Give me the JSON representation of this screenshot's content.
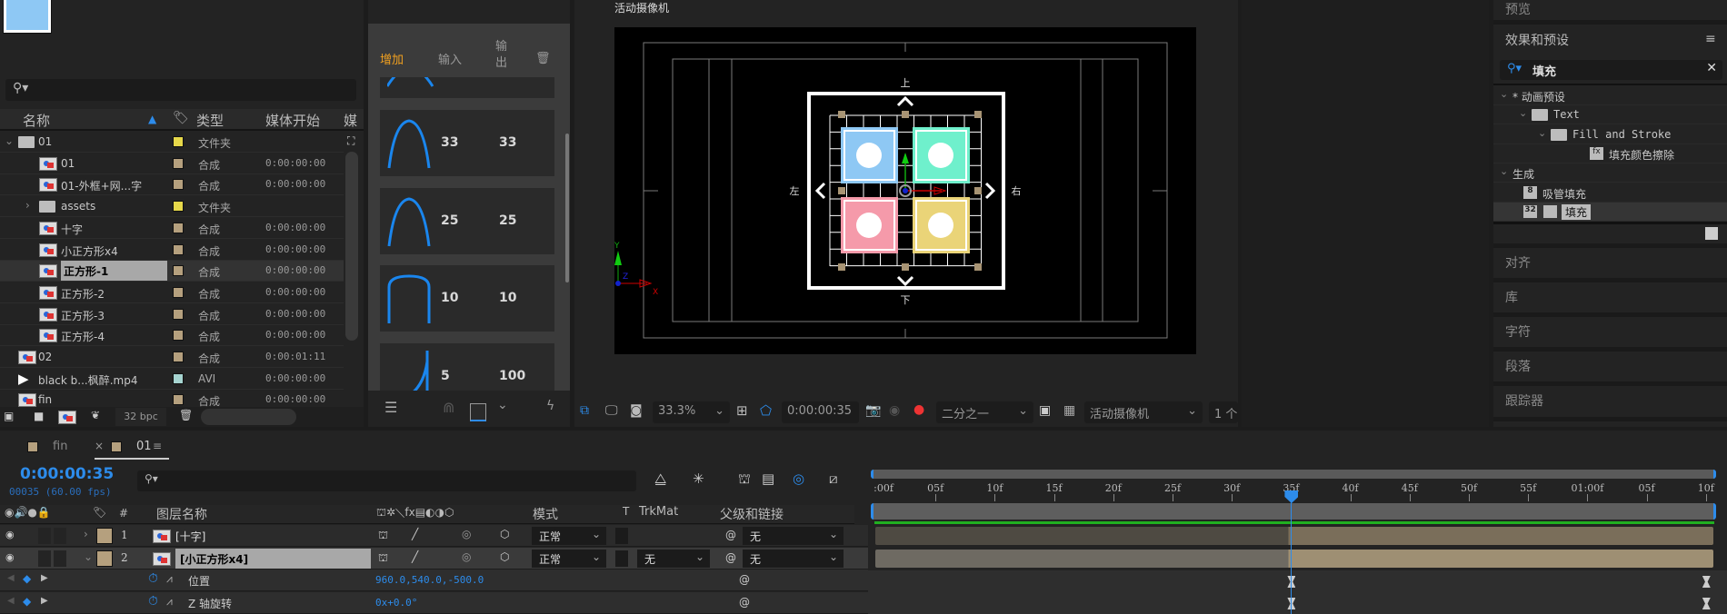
{
  "project": {
    "search_placeholder": "",
    "columns": {
      "name": "名称",
      "type": "类型",
      "media_start": "媒体开始",
      "media_more": "媒"
    },
    "items": [
      {
        "name": "01",
        "type": "文件夹",
        "start": "",
        "kind": "folder",
        "label": "#e6d84a",
        "indent": 0,
        "expanded": true
      },
      {
        "name": "01",
        "type": "合成",
        "start": "0:00:00:00",
        "kind": "comp",
        "label": "#b5a07e",
        "indent": 1
      },
      {
        "name": "01-外框+网...字",
        "type": "合成",
        "start": "0:00:00:00",
        "kind": "comp",
        "label": "#b5a07e",
        "indent": 1
      },
      {
        "name": "assets",
        "type": "文件夹",
        "start": "",
        "kind": "folder",
        "label": "#e6d84a",
        "indent": 1,
        "expanded": false
      },
      {
        "name": "十字",
        "type": "合成",
        "start": "0:00:00:00",
        "kind": "comp",
        "label": "#b5a07e",
        "indent": 1
      },
      {
        "name": "小正方形x4",
        "type": "合成",
        "start": "0:00:00:00",
        "kind": "comp",
        "label": "#b5a07e",
        "indent": 1
      },
      {
        "name": "正方形-1",
        "type": "合成",
        "start": "0:00:00:00",
        "kind": "comp",
        "label": "#b5a07e",
        "indent": 1,
        "selected": true
      },
      {
        "name": "正方形-2",
        "type": "合成",
        "start": "0:00:00:00",
        "kind": "comp",
        "label": "#b5a07e",
        "indent": 1
      },
      {
        "name": "正方形-3",
        "type": "合成",
        "start": "0:00:00:00",
        "kind": "comp",
        "label": "#b5a07e",
        "indent": 1
      },
      {
        "name": "正方形-4",
        "type": "合成",
        "start": "0:00:00:00",
        "kind": "comp",
        "label": "#b5a07e",
        "indent": 1
      },
      {
        "name": "02",
        "type": "合成",
        "start": "0:00:01:11",
        "kind": "comp",
        "label": "#b5a07e",
        "indent": 0
      },
      {
        "name": "black b...枫醉.mp4",
        "type": "AVI",
        "start": "0:00:00:00",
        "kind": "video",
        "label": "#a6d4d0",
        "indent": 0
      },
      {
        "name": "fin",
        "type": "合成",
        "start": "0:00:00:00",
        "kind": "comp",
        "label": "#b5a07e",
        "indent": 0
      }
    ],
    "bpc": "32 bpc"
  },
  "ease_panel": {
    "tabs": {
      "add": "增加",
      "in": "输入",
      "out_1": "输",
      "out_2": "出"
    },
    "accent": "#f0a020",
    "presets": [
      {
        "in": "33",
        "out": "33",
        "curve": "bell"
      },
      {
        "in": "25",
        "out": "25",
        "curve": "bell"
      },
      {
        "in": "10",
        "out": "10",
        "curve": "plateau"
      },
      {
        "in": "5",
        "out": "100",
        "curve": "spike"
      }
    ]
  },
  "viewer": {
    "title": "活动摄像机",
    "labels": {
      "up": "上",
      "down": "下",
      "left": "左",
      "right": "右"
    },
    "axes": {
      "x": "X",
      "y": "Y",
      "z": "Z"
    },
    "tile_colors": [
      "#8ec8f4",
      "#6ff0cc",
      "#f59aaa",
      "#ead478"
    ],
    "toolbar": {
      "zoom": "33.3%",
      "timecode": "0:00:00:35",
      "resolution": "二分之一",
      "camera": "活动摄像机",
      "views": "1 个"
    }
  },
  "right_panel": {
    "preview": "预览",
    "effects_title": "效果和预设",
    "search_value": "填充",
    "tree": [
      {
        "label": "* 动画预设",
        "level": 0
      },
      {
        "label": "Text",
        "level": 1
      },
      {
        "label": "Fill and Stroke",
        "level": 2
      },
      {
        "label": "填充颜色擦除",
        "level": 3
      },
      {
        "label": "生成",
        "level": 0
      },
      {
        "label": "吸管填充",
        "level": 1,
        "badge": "8"
      },
      {
        "label": "填充",
        "level": 1,
        "badge": "32",
        "selected": true
      }
    ],
    "panels": [
      "对齐",
      "库",
      "字符",
      "段落",
      "跟踪器"
    ]
  },
  "timeline": {
    "tabs": [
      {
        "label": "fin",
        "active": false
      },
      {
        "label": "01",
        "active": true
      }
    ],
    "timecode": "0:00:00:35",
    "frame_info": "00035 (60.00 fps)",
    "columns": {
      "layer_name": "图层名称",
      "hash": "#",
      "mode": "模式",
      "t": "T",
      "trkmat": "TrkMat",
      "parent": "父级和链接"
    },
    "layers": [
      {
        "index": "1",
        "name": "[十字]",
        "mode": "正常",
        "trkmat": "",
        "parent": "无"
      },
      {
        "index": "2",
        "name": "[小正方形x4]",
        "mode": "正常",
        "trkmat": "无",
        "parent": "无",
        "selected": true
      }
    ],
    "properties": [
      {
        "name": "位置",
        "value": "960.0,540.0,-500.0"
      },
      {
        "name": "Z 轴旋转",
        "value": "0x+0.0°"
      }
    ],
    "ruler": [
      ":00f",
      "05f",
      "10f",
      "15f",
      "20f",
      "25f",
      "30f",
      "35f",
      "40f",
      "45f",
      "50f",
      "55f",
      "01:00f",
      "05f",
      "10f"
    ],
    "current_frame": 35,
    "keyframe_frames": [
      35,
      70
    ],
    "accent": "#2d8ceb"
  }
}
